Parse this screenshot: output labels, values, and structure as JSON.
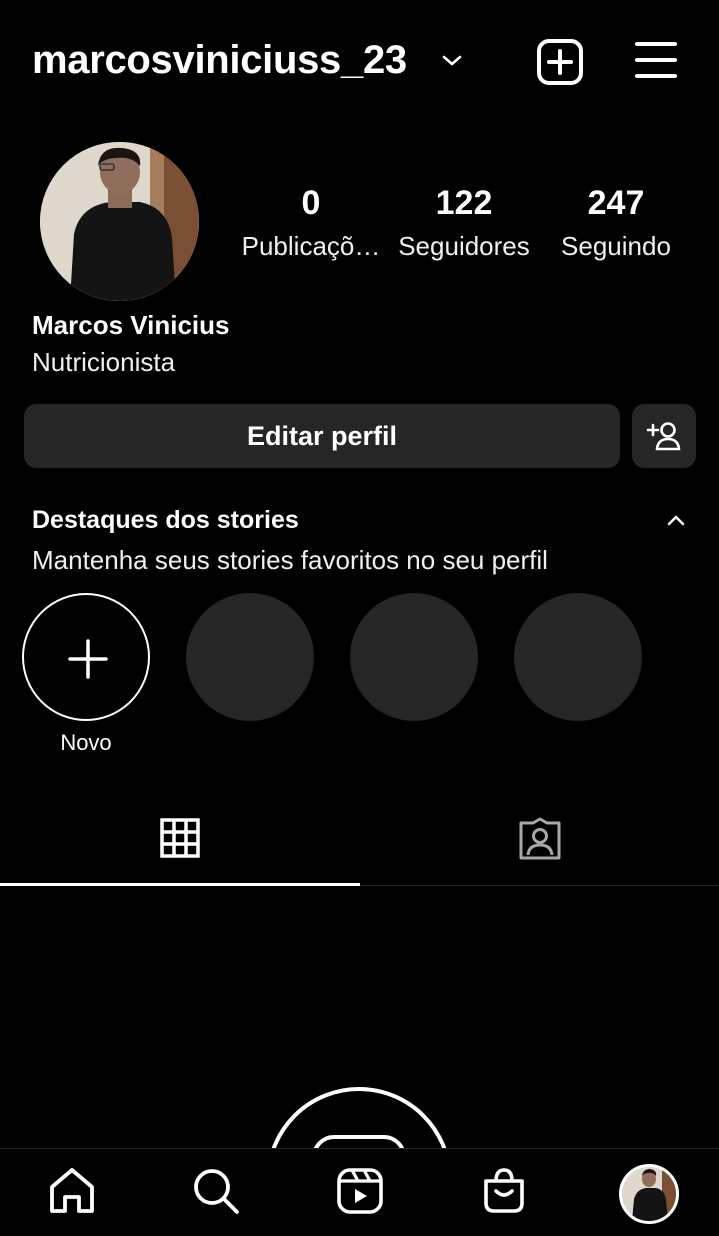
{
  "header": {
    "username": "marcosviniciuss_23",
    "chevron_icon": "chevron-down-icon",
    "new_post_icon": "plus-square-icon",
    "menu_icon": "hamburger-menu-icon"
  },
  "profile": {
    "stats": [
      {
        "value": "0",
        "label": "Publicaçõ…"
      },
      {
        "value": "122",
        "label": "Seguidores"
      },
      {
        "value": "247",
        "label": "Seguindo"
      }
    ],
    "full_name": "Marcos Vinicius",
    "bio": "Nutricionista"
  },
  "actions": {
    "edit_label": "Editar perfil",
    "discover_people_icon": "add-user-icon"
  },
  "highlights": {
    "title": "Destaques dos stories",
    "subtitle": "Mantenha seus stories favoritos no seu perfil",
    "new_label": "Novo"
  },
  "tabs": {
    "grid_icon": "grid-icon",
    "tagged_icon": "tagged-person-icon",
    "active": "grid"
  },
  "bottom_nav": {
    "items": [
      "home-icon",
      "search-icon",
      "reels-icon",
      "shop-icon",
      "profile-avatar"
    ]
  },
  "colors": {
    "background": "#000000",
    "button_bg": "#262626",
    "text": "#ffffff"
  }
}
